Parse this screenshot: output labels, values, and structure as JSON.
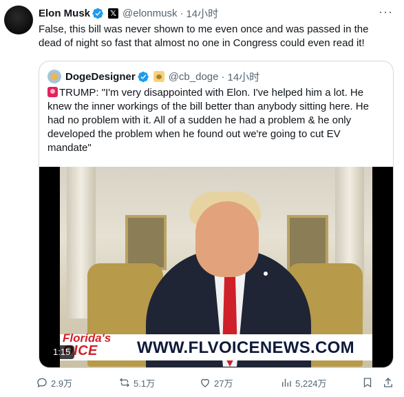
{
  "post": {
    "author_name": "Elon Musk",
    "author_handle": "@elonmusk",
    "separator": "·",
    "time": "14小时",
    "text": "False, this bill was never shown to me even once and was passed in the dead of night so fast that almost no one in Congress could even read it!",
    "more_label": "···",
    "affiliation_badge": "𝕏"
  },
  "quote": {
    "author_name": "DogeDesigner",
    "author_handle": "@cb_doge",
    "separator": "·",
    "time": "14小时",
    "text": "TRUMP: \"I'm very disappointed with Elon. I've helped him a lot. He knew the inner workings of the bill better than anybody sitting here. He had no problem with it. All of a sudden he had a problem & he only developed the problem when he found out we're going to cut EV mandate\"",
    "video": {
      "duration": "1:15",
      "logo_line1": "Florida's",
      "logo_line2": "OICE",
      "banner_url": "WWW.FLVOICENEWS.COM"
    }
  },
  "actions": {
    "replies": "2.9万",
    "reposts": "5.1万",
    "likes": "27万",
    "views": "5,224万"
  },
  "colors": {
    "text_primary": "#0f1419",
    "text_secondary": "#536471",
    "verified": "#1d9bf0",
    "border": "#cfd9de"
  }
}
